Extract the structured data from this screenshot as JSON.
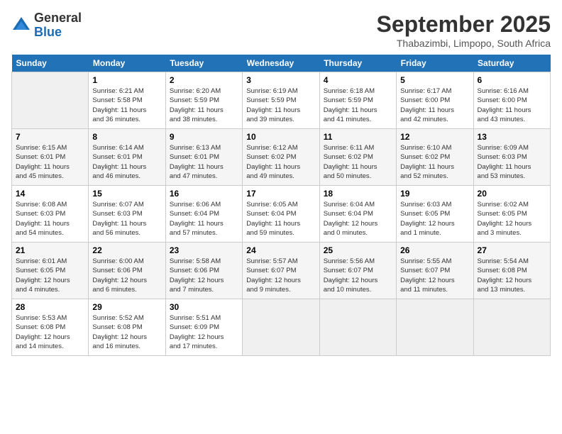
{
  "header": {
    "logo_general": "General",
    "logo_blue": "Blue",
    "month": "September 2025",
    "location": "Thabazimbi, Limpopo, South Africa"
  },
  "weekdays": [
    "Sunday",
    "Monday",
    "Tuesday",
    "Wednesday",
    "Thursday",
    "Friday",
    "Saturday"
  ],
  "weeks": [
    [
      {
        "num": "",
        "info": ""
      },
      {
        "num": "1",
        "info": "Sunrise: 6:21 AM\nSunset: 5:58 PM\nDaylight: 11 hours\nand 36 minutes."
      },
      {
        "num": "2",
        "info": "Sunrise: 6:20 AM\nSunset: 5:59 PM\nDaylight: 11 hours\nand 38 minutes."
      },
      {
        "num": "3",
        "info": "Sunrise: 6:19 AM\nSunset: 5:59 PM\nDaylight: 11 hours\nand 39 minutes."
      },
      {
        "num": "4",
        "info": "Sunrise: 6:18 AM\nSunset: 5:59 PM\nDaylight: 11 hours\nand 41 minutes."
      },
      {
        "num": "5",
        "info": "Sunrise: 6:17 AM\nSunset: 6:00 PM\nDaylight: 11 hours\nand 42 minutes."
      },
      {
        "num": "6",
        "info": "Sunrise: 6:16 AM\nSunset: 6:00 PM\nDaylight: 11 hours\nand 43 minutes."
      }
    ],
    [
      {
        "num": "7",
        "info": "Sunrise: 6:15 AM\nSunset: 6:01 PM\nDaylight: 11 hours\nand 45 minutes."
      },
      {
        "num": "8",
        "info": "Sunrise: 6:14 AM\nSunset: 6:01 PM\nDaylight: 11 hours\nand 46 minutes."
      },
      {
        "num": "9",
        "info": "Sunrise: 6:13 AM\nSunset: 6:01 PM\nDaylight: 11 hours\nand 47 minutes."
      },
      {
        "num": "10",
        "info": "Sunrise: 6:12 AM\nSunset: 6:02 PM\nDaylight: 11 hours\nand 49 minutes."
      },
      {
        "num": "11",
        "info": "Sunrise: 6:11 AM\nSunset: 6:02 PM\nDaylight: 11 hours\nand 50 minutes."
      },
      {
        "num": "12",
        "info": "Sunrise: 6:10 AM\nSunset: 6:02 PM\nDaylight: 11 hours\nand 52 minutes."
      },
      {
        "num": "13",
        "info": "Sunrise: 6:09 AM\nSunset: 6:03 PM\nDaylight: 11 hours\nand 53 minutes."
      }
    ],
    [
      {
        "num": "14",
        "info": "Sunrise: 6:08 AM\nSunset: 6:03 PM\nDaylight: 11 hours\nand 54 minutes."
      },
      {
        "num": "15",
        "info": "Sunrise: 6:07 AM\nSunset: 6:03 PM\nDaylight: 11 hours\nand 56 minutes."
      },
      {
        "num": "16",
        "info": "Sunrise: 6:06 AM\nSunset: 6:04 PM\nDaylight: 11 hours\nand 57 minutes."
      },
      {
        "num": "17",
        "info": "Sunrise: 6:05 AM\nSunset: 6:04 PM\nDaylight: 11 hours\nand 59 minutes."
      },
      {
        "num": "18",
        "info": "Sunrise: 6:04 AM\nSunset: 6:04 PM\nDaylight: 12 hours\nand 0 minutes."
      },
      {
        "num": "19",
        "info": "Sunrise: 6:03 AM\nSunset: 6:05 PM\nDaylight: 12 hours\nand 1 minute."
      },
      {
        "num": "20",
        "info": "Sunrise: 6:02 AM\nSunset: 6:05 PM\nDaylight: 12 hours\nand 3 minutes."
      }
    ],
    [
      {
        "num": "21",
        "info": "Sunrise: 6:01 AM\nSunset: 6:05 PM\nDaylight: 12 hours\nand 4 minutes."
      },
      {
        "num": "22",
        "info": "Sunrise: 6:00 AM\nSunset: 6:06 PM\nDaylight: 12 hours\nand 6 minutes."
      },
      {
        "num": "23",
        "info": "Sunrise: 5:58 AM\nSunset: 6:06 PM\nDaylight: 12 hours\nand 7 minutes."
      },
      {
        "num": "24",
        "info": "Sunrise: 5:57 AM\nSunset: 6:07 PM\nDaylight: 12 hours\nand 9 minutes."
      },
      {
        "num": "25",
        "info": "Sunrise: 5:56 AM\nSunset: 6:07 PM\nDaylight: 12 hours\nand 10 minutes."
      },
      {
        "num": "26",
        "info": "Sunrise: 5:55 AM\nSunset: 6:07 PM\nDaylight: 12 hours\nand 11 minutes."
      },
      {
        "num": "27",
        "info": "Sunrise: 5:54 AM\nSunset: 6:08 PM\nDaylight: 12 hours\nand 13 minutes."
      }
    ],
    [
      {
        "num": "28",
        "info": "Sunrise: 5:53 AM\nSunset: 6:08 PM\nDaylight: 12 hours\nand 14 minutes."
      },
      {
        "num": "29",
        "info": "Sunrise: 5:52 AM\nSunset: 6:08 PM\nDaylight: 12 hours\nand 16 minutes."
      },
      {
        "num": "30",
        "info": "Sunrise: 5:51 AM\nSunset: 6:09 PM\nDaylight: 12 hours\nand 17 minutes."
      },
      {
        "num": "",
        "info": ""
      },
      {
        "num": "",
        "info": ""
      },
      {
        "num": "",
        "info": ""
      },
      {
        "num": "",
        "info": ""
      }
    ]
  ]
}
